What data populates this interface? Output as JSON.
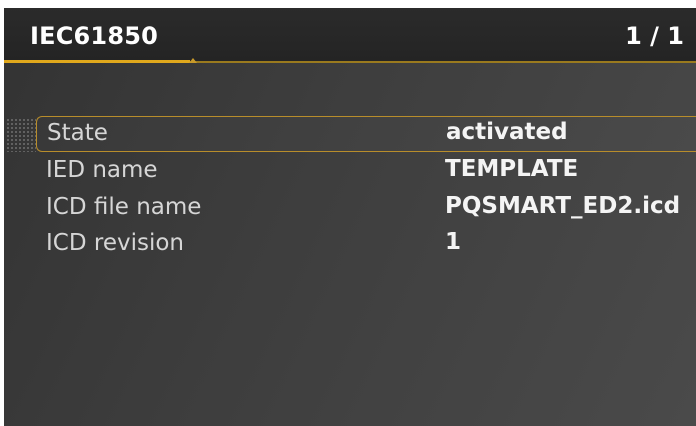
{
  "header": {
    "title": "IEC61850",
    "page_indicator": "1 / 1"
  },
  "colors": {
    "accent": "#e0a81c",
    "selection_border": "#b88d2b",
    "header_bg": "#262626",
    "body_bg": "#3d3d3d"
  },
  "rows": [
    {
      "label": "State",
      "value": "activated",
      "selected": true
    },
    {
      "label": "IED name",
      "value": "TEMPLATE",
      "selected": false
    },
    {
      "label": "ICD file name",
      "value": "PQSMART_ED2.icd",
      "selected": false
    },
    {
      "label": "ICD revision",
      "value": "1",
      "selected": false
    }
  ]
}
